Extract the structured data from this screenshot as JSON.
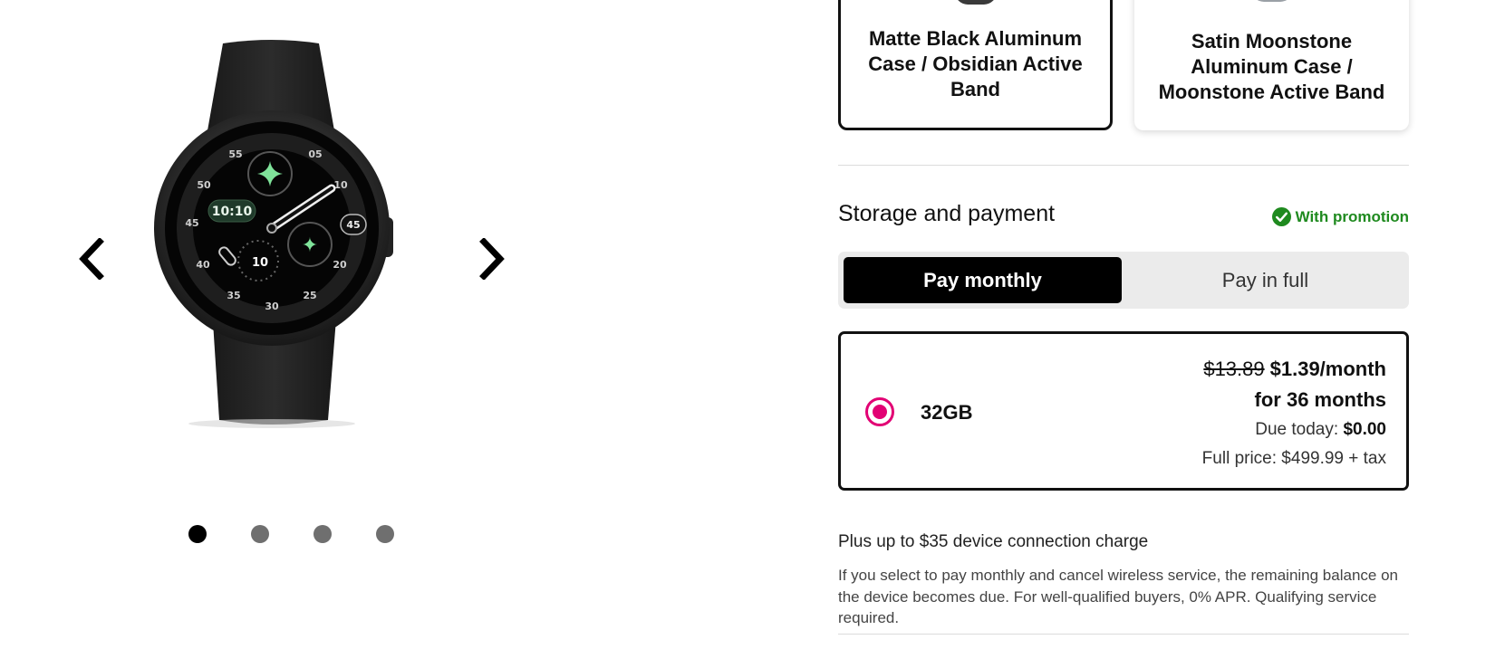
{
  "gallery": {
    "prev_icon": "chevron-left-icon",
    "next_icon": "chevron-right-icon",
    "image_alt": "watch-image",
    "watch_face": {
      "time": "10:10",
      "chip_right": "45",
      "sub_dial": "10",
      "ticks": [
        "55",
        "05",
        "50",
        "10",
        "45",
        "40",
        "20",
        "35",
        "25",
        "30"
      ]
    },
    "dots": [
      {
        "active": true
      },
      {
        "active": false
      },
      {
        "active": false
      },
      {
        "active": false
      }
    ]
  },
  "variants": [
    {
      "label": "Matte Black Aluminum Case / Obsidian Active Band",
      "selected": true
    },
    {
      "label": "Satin Moonstone Aluminum Case / Moonstone Active Band",
      "selected": false
    }
  ],
  "storage": {
    "title": "Storage and payment",
    "promo_label": "With promotion",
    "promo_icon": "check-circle-icon",
    "toggle": {
      "monthly": "Pay monthly",
      "full": "Pay in full",
      "selected": "monthly"
    },
    "option": {
      "size": "32GB",
      "old_price": "$13.89",
      "price": "$1.39/month",
      "term": "for 36 months",
      "due_label": "Due today:",
      "due_value": "$0.00",
      "full_price": "Full price: $499.99 + tax",
      "selected": true
    },
    "charge_note": "Plus up to $35 device connection charge",
    "disclaimer": "If you select to pay monthly and cancel wireless service, the remaining balance on the device becomes due. For well-qualified buyers, 0% APR. Qualifying service required."
  },
  "colors": {
    "accent": "#e20074",
    "promo_green": "#1f8a1f",
    "selected_bg": "#000000",
    "toggle_bg": "#ebebeb"
  }
}
